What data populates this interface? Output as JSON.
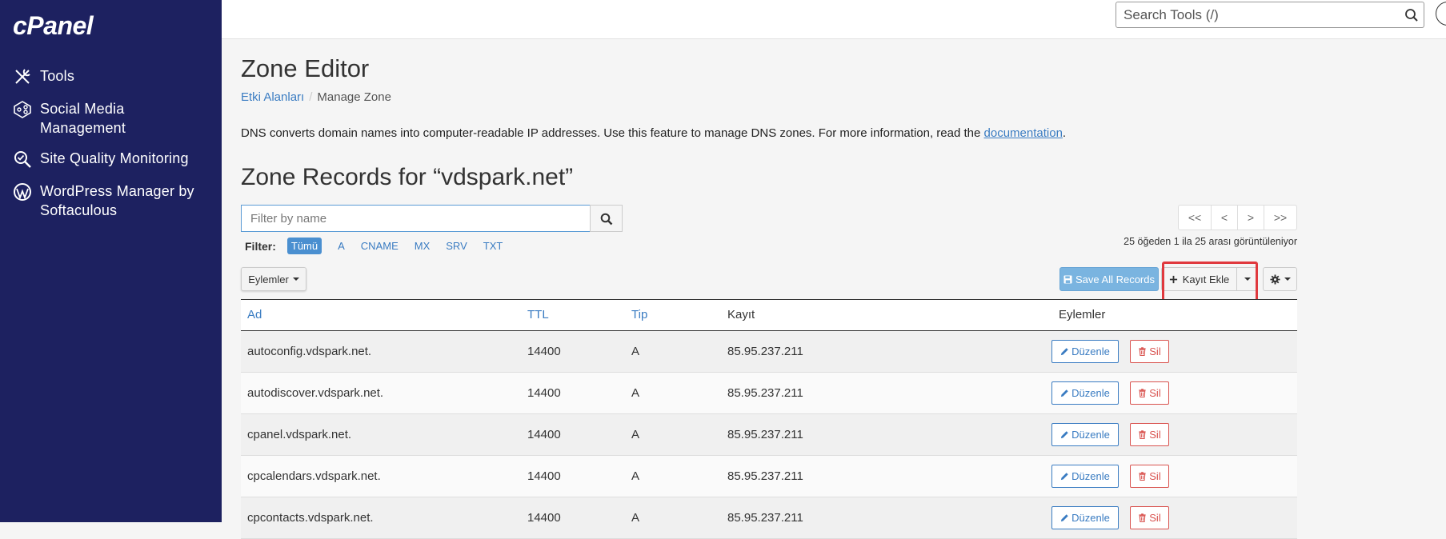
{
  "sidebar": {
    "logo": "cPanel",
    "items": [
      {
        "label": "Tools",
        "icon": "tools-icon"
      },
      {
        "label": "Social Media Management",
        "icon": "social-media-icon"
      },
      {
        "label": "Site Quality Monitoring",
        "icon": "site-quality-icon"
      },
      {
        "label": "WordPress Manager by Softaculous",
        "icon": "wordpress-icon"
      }
    ]
  },
  "topbar": {
    "search_placeholder": "Search Tools (/)"
  },
  "page": {
    "title": "Zone Editor",
    "breadcrumb": [
      "Etki Alanları",
      "Manage Zone"
    ],
    "description_prefix": "DNS converts domain names into computer-readable IP addresses. Use this feature to manage DNS zones. For more information, read the ",
    "description_link": "documentation",
    "description_suffix": ".",
    "zone_title": "Zone Records for “vdspark.net”"
  },
  "filter": {
    "placeholder": "Filter by name",
    "label": "Filter:",
    "options": [
      "Tümü",
      "A",
      "CNAME",
      "MX",
      "SRV",
      "TXT"
    ],
    "active": "Tümü"
  },
  "pager": {
    "buttons": [
      "<<",
      "<",
      ">",
      ">>"
    ],
    "info": "25 öğeden 1 ila 25 arası görüntüleniyor"
  },
  "toolbar": {
    "actions_label": "Eylemler",
    "save_label": "Save All Records",
    "add_label": "Kayıt Ekle"
  },
  "table": {
    "headers": {
      "name": "Ad",
      "ttl": "TTL",
      "type": "Tip",
      "record": "Kayıt",
      "actions": "Eylemler"
    },
    "edit_label": "Düzenle",
    "delete_label": "Sil",
    "rows": [
      {
        "name": "autoconfig.vdspark.net.",
        "ttl": "14400",
        "type": "A",
        "record": "85.95.237.211"
      },
      {
        "name": "autodiscover.vdspark.net.",
        "ttl": "14400",
        "type": "A",
        "record": "85.95.237.211"
      },
      {
        "name": "cpanel.vdspark.net.",
        "ttl": "14400",
        "type": "A",
        "record": "85.95.237.211"
      },
      {
        "name": "cpcalendars.vdspark.net.",
        "ttl": "14400",
        "type": "A",
        "record": "85.95.237.211"
      },
      {
        "name": "cpcontacts.vdspark.net.",
        "ttl": "14400",
        "type": "A",
        "record": "85.95.237.211"
      }
    ]
  },
  "colors": {
    "sidebar_bg": "#1d2160",
    "link": "#3a7cc2",
    "danger": "#d9534f",
    "highlight": "#e0393e"
  }
}
